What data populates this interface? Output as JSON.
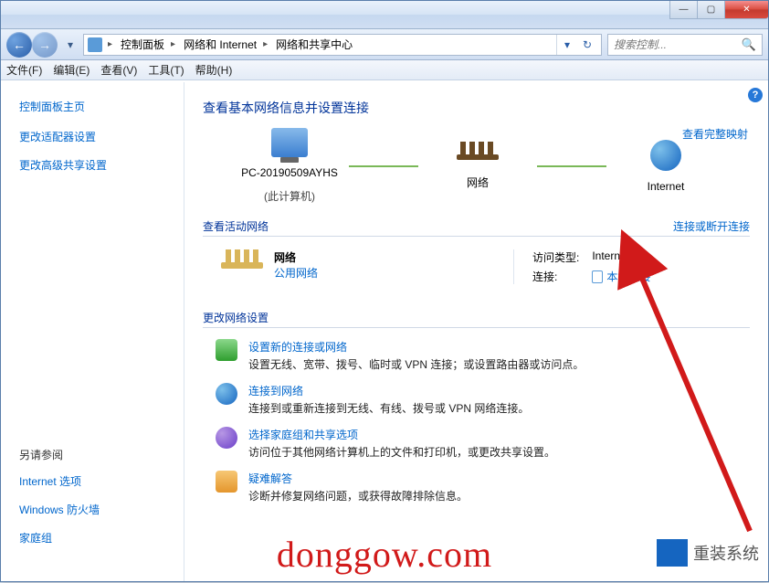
{
  "titlebar": {
    "title_hint": ""
  },
  "winbtns": {
    "min": "—",
    "max": "▢",
    "close": "✕"
  },
  "nav": {
    "back_icon": "←",
    "fwd_icon": "→",
    "drop": "▾"
  },
  "breadcrumbs": {
    "root_chev": "▸",
    "items": [
      "控制面板",
      "网络和 Internet",
      "网络和共享中心"
    ],
    "chev": "▸"
  },
  "addr_buttons": {
    "dropdown": "▾",
    "refresh": "↻"
  },
  "search": {
    "placeholder": "搜索控制...",
    "icon": "🔍"
  },
  "menubar": [
    "文件(F)",
    "编辑(E)",
    "查看(V)",
    "工具(T)",
    "帮助(H)"
  ],
  "sidebar": {
    "home": "控制面板主页",
    "links": [
      "更改适配器设置",
      "更改高级共享设置"
    ],
    "seealso_heading": "另请参阅",
    "seealso": [
      "Internet 选项",
      "Windows 防火墙",
      "家庭组"
    ]
  },
  "main": {
    "help": "?",
    "page_title": "查看基本网络信息并设置连接",
    "map": {
      "pc_name": "PC-20190509AYHS",
      "pc_sub": "(此计算机)",
      "net_name": "网络",
      "internet": "Internet",
      "full_map_link": "查看完整映射"
    },
    "active_section": {
      "title": "查看活动网络",
      "right_link": "连接或断开连接",
      "netname": "网络",
      "nettype": "公用网络",
      "access_label": "访问类型:",
      "access_value": "Internet",
      "conn_label": "连接:",
      "conn_value": "本地连接"
    },
    "change_section_title": "更改网络设置",
    "options": [
      {
        "title": "设置新的连接或网络",
        "desc": "设置无线、宽带、拨号、临时或 VPN 连接；或设置路由器或访问点。"
      },
      {
        "title": "连接到网络",
        "desc": "连接到或重新连接到无线、有线、拨号或 VPN 网络连接。"
      },
      {
        "title": "选择家庭组和共享选项",
        "desc": "访问位于其他网络计算机上的文件和打印机，或更改共享设置。"
      },
      {
        "title": "疑难解答",
        "desc": "诊断并修复网络问题，或获得故障排除信息。"
      }
    ]
  },
  "watermark": "donggow.com",
  "wm_right_text": "  重装系统"
}
